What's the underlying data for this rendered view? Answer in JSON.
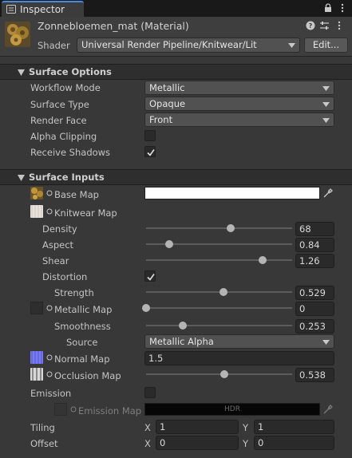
{
  "tab": {
    "label": "Inspector"
  },
  "header": {
    "title": "Zonnebloemen_mat (Material)",
    "shader_label": "Shader",
    "shader_value": "Universal Render Pipeline/Knitwear/Lit",
    "edit_label": "Edit..."
  },
  "surface_options": {
    "title": "Surface Options",
    "workflow_label": "Workflow Mode",
    "workflow_value": "Metallic",
    "surface_type_label": "Surface Type",
    "surface_type_value": "Opaque",
    "render_face_label": "Render Face",
    "render_face_value": "Front",
    "alpha_clipping_label": "Alpha Clipping",
    "alpha_clipping": false,
    "receive_shadows_label": "Receive Shadows",
    "receive_shadows": true
  },
  "surface_inputs": {
    "title": "Surface Inputs",
    "base_map_label": "Base Map",
    "knitwear_map_label": "Knitwear Map",
    "density_label": "Density",
    "density_value": "68",
    "density_fraction": 0.58,
    "aspect_label": "Aspect",
    "aspect_value": "0.84",
    "aspect_fraction": 0.16,
    "shear_label": "Shear",
    "shear_value": "1.26",
    "shear_fraction": 0.8,
    "distortion_label": "Distortion",
    "distortion": true,
    "strength_label": "Strength",
    "strength_value": "0.529",
    "strength_fraction": 0.529,
    "metallic_map_label": "Metallic Map",
    "metallic_value": "0",
    "metallic_fraction": 0.0,
    "smoothness_label": "Smoothness",
    "smoothness_value": "0.253",
    "smoothness_fraction": 0.253,
    "source_label": "Source",
    "source_value": "Metallic Alpha",
    "normal_map_label": "Normal Map",
    "normal_value": "1.5",
    "occlusion_map_label": "Occlusion Map",
    "occlusion_value": "0.538",
    "occlusion_fraction": 0.538,
    "emission_label": "Emission",
    "emission": false,
    "emission_map_label": "Emission Map",
    "emission_hdr": "HDR",
    "tiling_label": "Tiling",
    "tiling_x_label": "X",
    "tiling_x": "1",
    "tiling_y_label": "Y",
    "tiling_y": "1",
    "offset_label": "Offset",
    "offset_x_label": "X",
    "offset_x": "0",
    "offset_y_label": "Y",
    "offset_y": "0"
  },
  "colors": {
    "accent": "#4a8ade",
    "background": "#383838",
    "field": "#2a2a2a",
    "dropdown": "#515151"
  },
  "icons": {
    "tab": "inspector-icon",
    "lock": "lock-icon",
    "menu": "kebab-menu-icon",
    "help": "help-icon",
    "presets": "presets-sliders-icon",
    "picker": "object-picker-icon",
    "foldout": "foldout-triangle-icon",
    "texture_dot": "texture-slot-dot-icon"
  }
}
